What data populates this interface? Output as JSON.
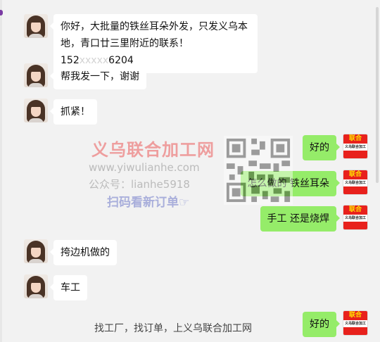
{
  "messages": {
    "m1_line1": "你好，大批量的铁丝耳朵外发，只发义乌本",
    "m1_line2_a": "地，青口廿三里附近的联系！152",
    "m1_line2_masked": "xxxxx",
    "m1_line2_b": "6204",
    "m2": "帮我发一下，谢谢",
    "m3": "抓紧！",
    "m4": "好的",
    "m5": "怎么做的 铁丝耳朵",
    "m6": "手工 还是烧焊",
    "m7": "挎边机做的",
    "m8": "车工",
    "m9": "好的"
  },
  "watermark": {
    "title": "义乌联合加工网",
    "url": "www.yiwulianhe.com",
    "gzh": "公众号：lianhe5918",
    "scan": "扫码看新订单☞"
  },
  "brand_avatar": {
    "top": "联合",
    "mid": "义乌联合加工网",
    "bot": ""
  },
  "caption": "找工厂，找订单，上义乌联合加工网",
  "colors": {
    "self_bubble": "#95ec69",
    "other_bubble": "#ffffff",
    "background": "#f2f2f2",
    "brand_red": "#e8211c"
  }
}
